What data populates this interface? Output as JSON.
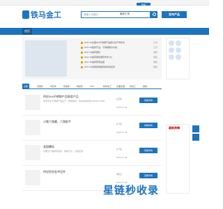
{
  "topbar": {
    "links": [
      "",
      "",
      ""
    ],
    "phone": "15262...",
    "login": "登录"
  },
  "header": {
    "logo_text": "铁马金工",
    "search_placeholder": "请输入关键字",
    "search_scope": "最新汇率",
    "publish_label": "发布产品"
  },
  "nav": {
    "home": "首页"
  },
  "news": [
    {
      "text": "2017-10全国304不锈钢产品报价生产作区市",
      "loc": "江苏"
    },
    {
      "text": "2017-10镀锌产品、不锈钢报价价格",
      "loc": "江苏"
    },
    {
      "text": "2017-10镀锌钢管",
      "loc": "福建"
    },
    {
      "text": "2017-10镀锌钢管钢管件件(大)",
      "loc": "福建"
    },
    {
      "text": "2017-10品牌家用设备",
      "loc": "福建"
    },
    {
      "text": "2017-10优质防锈镀锌材料供应商",
      "loc": "福建"
    }
  ],
  "categories": [
    "全部",
    "紧固件",
    "冲压件",
    "铸造件",
    "焊接件",
    "CNC",
    "模具加工",
    "表面处理",
    "机加工",
    "其他"
  ],
  "list": [
    {
      "title": "供应304不锈钢产品铸造产品",
      "desc": "我司专注不锈钢产品生产，质量保证，欢迎来电咨询 18936173658",
      "loc": "[江苏]",
      "date": "2025-07-08",
      "btn": "查看详情"
    },
    {
      "title": "订做六角圆、六角扳手",
      "desc": "",
      "loc": "[广东]",
      "date": "2025-07-08",
      "btn": "查看详情"
    },
    {
      "title": "紧固螺栓",
      "desc": "长期生产各种紧固件，规格齐全，价格优惠",
      "loc": "[广东]",
      "date": "2025-07-08",
      "btn": "查看详情"
    },
    {
      "title": "供应铝合金冲压件",
      "desc": "",
      "loc": "[浙江]",
      "date": "2025-07-08",
      "btn": "查看详情"
    }
  ],
  "side": {
    "title": "最新商情"
  },
  "watermark": "星链秒收录"
}
